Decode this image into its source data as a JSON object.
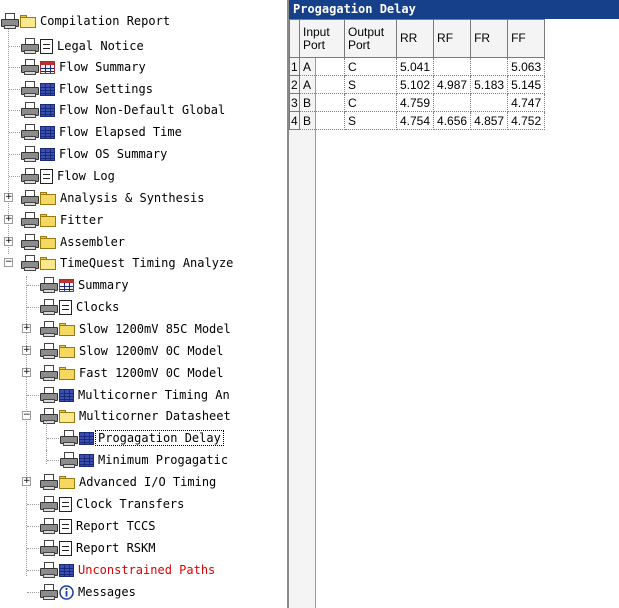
{
  "tree": {
    "items": [
      {
        "label": "Compilation Report",
        "icon": "printer-folder-open-icon"
      },
      {
        "label": "Legal Notice",
        "icon": "printer-document-icon"
      },
      {
        "label": "Flow Summary",
        "icon": "printer-flow-table-icon"
      },
      {
        "label": "Flow Settings",
        "icon": "printer-table-icon"
      },
      {
        "label": "Flow Non-Default Global",
        "icon": "printer-table-icon"
      },
      {
        "label": "Flow Elapsed Time",
        "icon": "printer-table-icon"
      },
      {
        "label": "Flow OS Summary",
        "icon": "printer-table-icon"
      },
      {
        "label": "Flow Log",
        "icon": "printer-document-icon"
      },
      {
        "label": "Analysis & Synthesis",
        "icon": "printer-folder-icon"
      },
      {
        "label": "Fitter",
        "icon": "printer-folder-icon"
      },
      {
        "label": "Assembler",
        "icon": "printer-folder-icon"
      },
      {
        "label": "TimeQuest Timing Analyze",
        "icon": "printer-folder-open-icon"
      },
      {
        "label": "Summary",
        "icon": "printer-flow-table-icon"
      },
      {
        "label": "Clocks",
        "icon": "printer-document-icon"
      },
      {
        "label": "Slow 1200mV 85C Model",
        "icon": "printer-folder-icon"
      },
      {
        "label": "Slow 1200mV 0C Model",
        "icon": "printer-folder-icon"
      },
      {
        "label": "Fast 1200mV 0C Model",
        "icon": "printer-folder-icon"
      },
      {
        "label": "Multicorner Timing An",
        "icon": "printer-table-icon"
      },
      {
        "label": "Multicorner Datasheet",
        "icon": "printer-folder-open-icon"
      },
      {
        "label": "Progagation Delay",
        "icon": "printer-table-icon"
      },
      {
        "label": "Minimum Progagatic",
        "icon": "printer-table-icon"
      },
      {
        "label": "Advanced I/O Timing",
        "icon": "printer-folder-icon"
      },
      {
        "label": "Clock Transfers",
        "icon": "printer-document-icon"
      },
      {
        "label": "Report TCCS",
        "icon": "printer-document-icon"
      },
      {
        "label": "Report RSKM",
        "icon": "printer-document-icon"
      },
      {
        "label": "Unconstrained Paths",
        "icon": "printer-table-icon",
        "color": "#e00000"
      },
      {
        "label": "Messages",
        "icon": "printer-info-icon"
      }
    ]
  },
  "panel": {
    "title": "Progagation Delay",
    "columns": [
      "",
      "Input\nPort",
      "Output\nPort",
      "RR",
      "RF",
      "FR",
      "FF"
    ],
    "rows": [
      {
        "num": "1",
        "input": "A",
        "output": "C",
        "rr": "5.041",
        "rf": "",
        "fr": "",
        "ff": "5.063"
      },
      {
        "num": "2",
        "input": "A",
        "output": "S",
        "rr": "5.102",
        "rf": "4.987",
        "fr": "5.183",
        "ff": "5.145"
      },
      {
        "num": "3",
        "input": "B",
        "output": "C",
        "rr": "4.759",
        "rf": "",
        "fr": "",
        "ff": "4.747"
      },
      {
        "num": "4",
        "input": "B",
        "output": "S",
        "rr": "4.754",
        "rf": "4.656",
        "fr": "4.857",
        "ff": "4.752"
      }
    ]
  },
  "colors": {
    "title_bar": "#16418a",
    "error_text": "#e00000"
  }
}
